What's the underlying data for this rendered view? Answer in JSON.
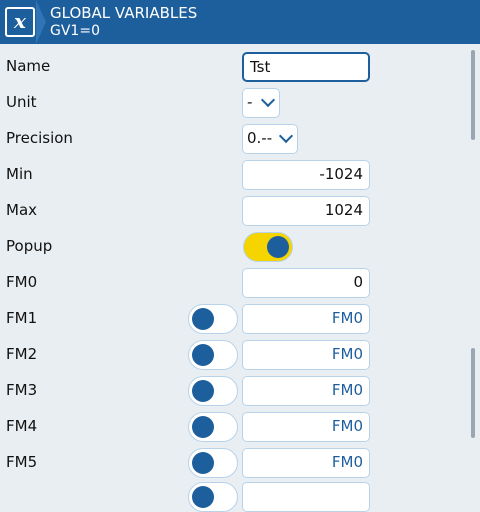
{
  "header": {
    "logo_letter": "x",
    "title": "GLOBAL VARIABLES",
    "subtitle": "GV1=0"
  },
  "fields": {
    "name": {
      "label": "Name",
      "value": "Tst"
    },
    "unit": {
      "label": "Unit",
      "value": "-"
    },
    "precision": {
      "label": "Precision",
      "value": "0.--"
    },
    "min": {
      "label": "Min",
      "value": "-1024"
    },
    "max": {
      "label": "Max",
      "value": "1024"
    },
    "popup": {
      "label": "Popup",
      "on": true
    },
    "fm0": {
      "label": "FM0",
      "value": "0"
    }
  },
  "fm_rows": [
    {
      "label": "FM1",
      "value": "FM0",
      "toggle_on": false
    },
    {
      "label": "FM2",
      "value": "FM0",
      "toggle_on": false
    },
    {
      "label": "FM3",
      "value": "FM0",
      "toggle_on": false
    },
    {
      "label": "FM4",
      "value": "FM0",
      "toggle_on": false
    },
    {
      "label": "FM5",
      "value": "FM0",
      "toggle_on": false
    }
  ],
  "colors": {
    "header": "#1d5f9c",
    "accent": "#1d5f9c",
    "toggle_on": "#f5d400",
    "background": "#e9eef2"
  }
}
